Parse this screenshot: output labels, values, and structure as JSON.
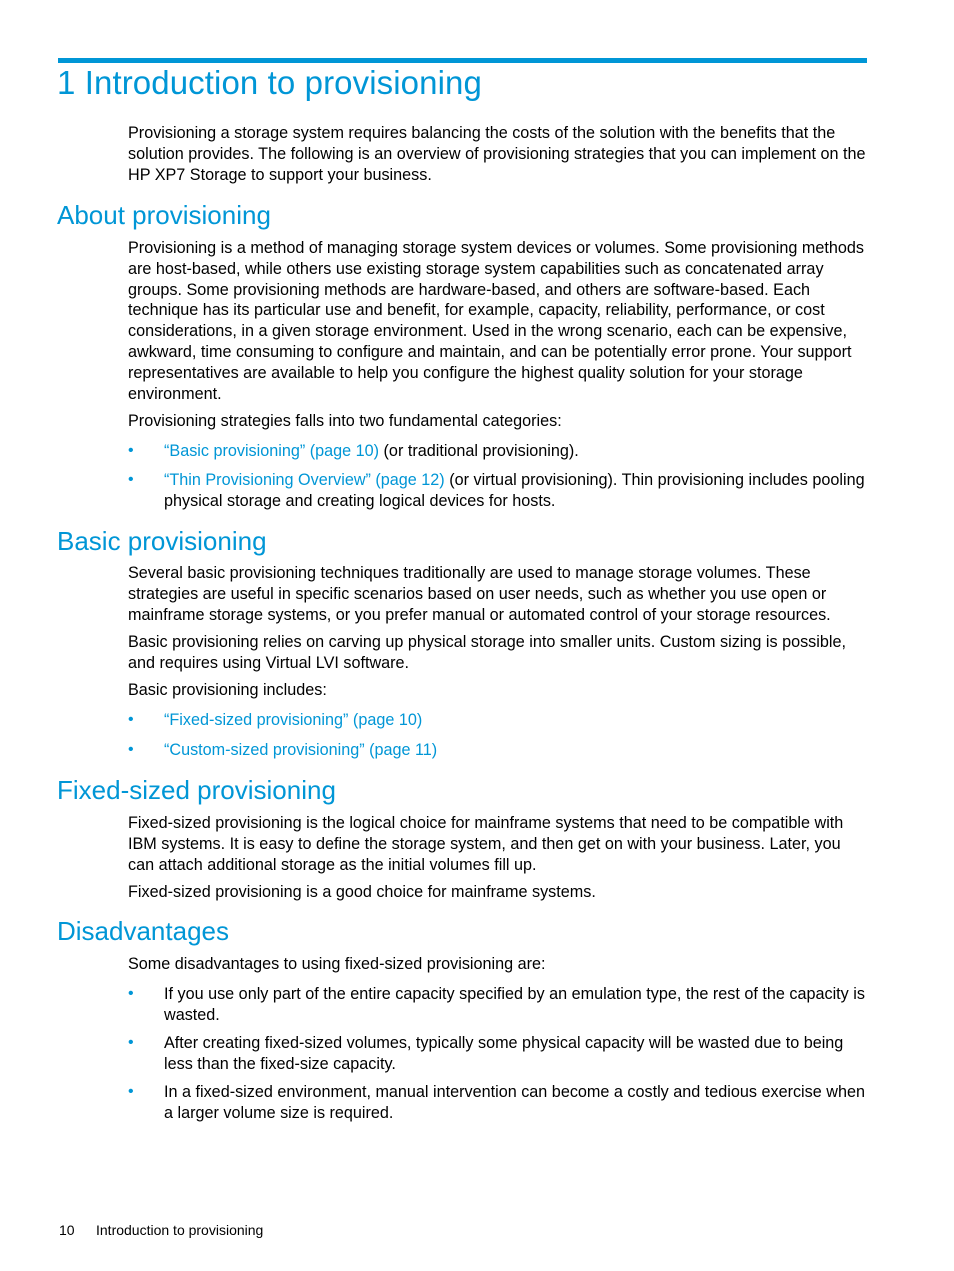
{
  "accent_color": "#0096d6",
  "chapter": {
    "title": "1 Introduction to provisioning",
    "intro": "Provisioning a storage system requires balancing the costs of the solution with the benefits that the solution provides. The following is an overview of provisioning strategies that you can implement on the HP XP7 Storage to support your business."
  },
  "about": {
    "heading": "About provisioning",
    "para1": "Provisioning is a method of managing storage system devices or volumes. Some provisioning methods are host-based, while others use existing storage system capabilities such as concatenated array groups. Some provisioning methods are hardware-based, and others are software-based. Each technique has its particular use and benefit, for example, capacity, reliability, performance, or cost considerations, in a given storage environment. Used in the wrong scenario, each can be expensive, awkward, time consuming to configure and maintain, and can be potentially error prone. Your support representatives are available to help you configure the highest quality solution for your storage environment.",
    "para2": "Provisioning strategies falls into two fundamental categories:",
    "bullets": [
      {
        "link": "“Basic provisioning” (page 10)",
        "text": " (or traditional provisioning)."
      },
      {
        "link": "“Thin Provisioning Overview” (page 12)",
        "text": " (or virtual provisioning). Thin provisioning includes pooling physical storage and creating logical devices for hosts."
      }
    ]
  },
  "basic": {
    "heading": "Basic provisioning",
    "para1": "Several basic provisioning techniques traditionally are used to manage storage volumes. These strategies are useful in specific scenarios based on user needs, such as whether you use open or mainframe storage systems, or you prefer manual or automated control of your storage resources.",
    "para2": "Basic provisioning relies on carving up physical storage into smaller units. Custom sizing is possible, and requires using Virtual LVI software.",
    "para3": "Basic provisioning includes:",
    "bullets": [
      {
        "link": "“Fixed-sized provisioning” (page 10)"
      },
      {
        "link": "“Custom-sized provisioning” (page 11)"
      }
    ]
  },
  "fixed": {
    "heading": "Fixed-sized provisioning",
    "para1": "Fixed-sized provisioning is the logical choice for mainframe systems that need to be compatible with IBM systems. It is easy to define the storage system, and then get on with your business. Later, you can attach additional storage as the initial volumes fill up.",
    "para2": "Fixed-sized provisioning is a good choice for mainframe systems."
  },
  "disadvantages": {
    "heading": "Disadvantages",
    "para1": "Some disadvantages to using fixed-sized provisioning are:",
    "bullets": [
      "If you use only part of the entire capacity specified by an emulation type, the rest of the capacity is wasted.",
      "After creating fixed-sized volumes, typically some physical capacity will be wasted due to being less than the fixed-size capacity.",
      "In a fixed-sized environment, manual intervention can become a costly and tedious exercise when a larger volume size is required."
    ]
  },
  "footer": {
    "page_number": "10",
    "chapter_title": "Introduction to provisioning"
  }
}
